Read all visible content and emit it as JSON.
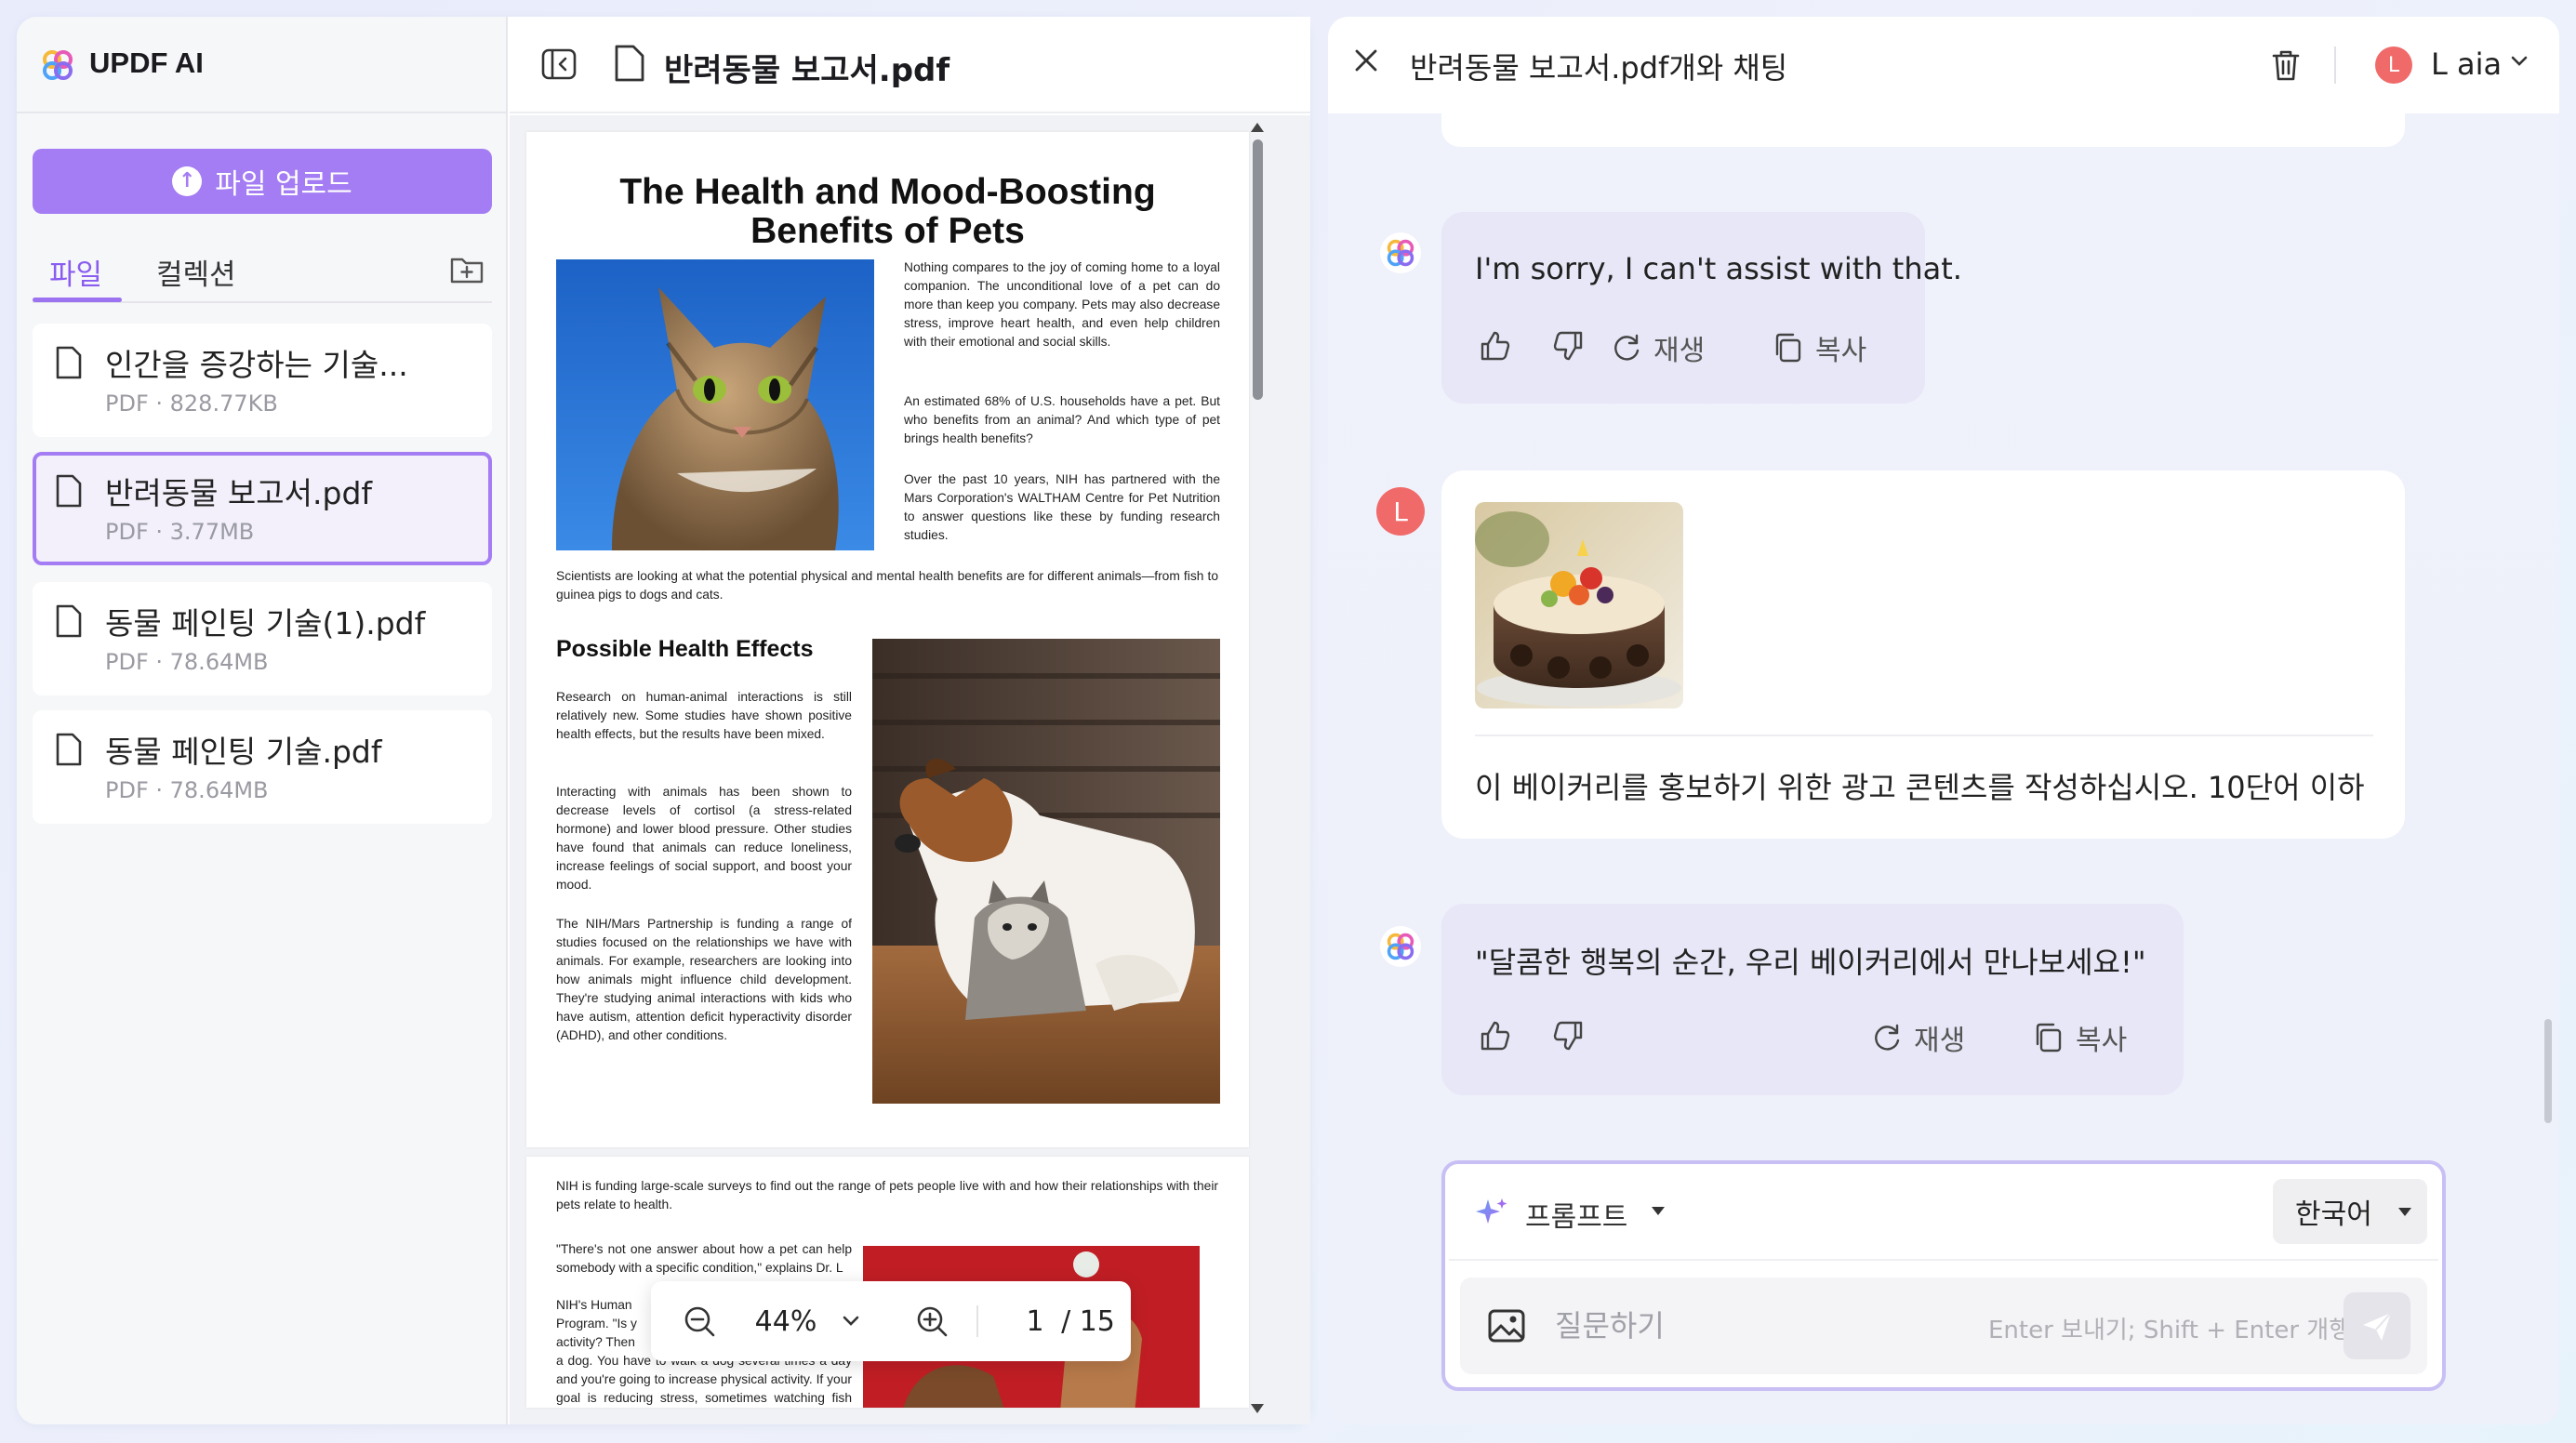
{
  "sidebar": {
    "app_title": "UPDF AI",
    "upload_label": "파일 업로드",
    "tabs": [
      {
        "label": "파일",
        "active": true
      },
      {
        "label": "컬렉션",
        "active": false
      }
    ],
    "files": [
      {
        "name": "인간을 증강하는 기술...",
        "meta": "PDF · 828.77KB",
        "selected": false
      },
      {
        "name": "반려동물 보고서.pdf",
        "meta": "PDF · 3.77MB",
        "selected": true
      },
      {
        "name": "동물 페인팅 기술(1).pdf",
        "meta": "PDF · 78.64MB",
        "selected": false
      },
      {
        "name": "동물 페인팅 기술.pdf",
        "meta": "PDF · 78.64MB",
        "selected": false
      }
    ]
  },
  "viewer": {
    "doc_title": "반려동물 보고서.pdf",
    "zoom": "44%",
    "page_current": "1",
    "page_total": "/ 15",
    "page1": {
      "title_line1": "The Health and Mood-Boosting",
      "title_line2": "Benefits of Pets",
      "intro_p1": "Nothing compares to the joy of coming home to a loyal companion. The unconditional love of a pet can do more than keep you company. Pets may also decrease stress, improve heart health, and even help children with their emotional and social skills.",
      "intro_p2": "An estimated 68% of U.S. households have a pet. But who benefits from an animal? And which type of pet brings health benefits?",
      "intro_p3": "Over the past 10 years, NIH has partnered with the Mars Corporation's WALTHAM Centre for Pet Nutrition to answer questions like these by funding research studies.",
      "scientists_p": "Scientists are looking at what the potential physical and mental health benefits are for different animals—from fish to guinea pigs to dogs and cats.",
      "section_heading": "Possible Health Effects",
      "effects_p1": "Research on human-animal interactions is still relatively new. Some studies have shown positive health effects, but the results have been mixed.",
      "effects_p2": "Interacting with animals has been shown to decrease levels of cortisol (a stress-related hormone) and lower blood pressure. Other studies have found that animals can reduce loneliness, increase feelings of social support, and boost your mood.",
      "effects_p3": "The NIH/Mars Partnership is funding a range of studies focused on the relationships we have with animals. For example, researchers are looking into how animals might influence child development. They're studying animal interactions with kids who have autism, attention deficit hyperactivity disorder (ADHD), and other conditions."
    },
    "page2": {
      "p1": "NIH is funding large-scale surveys to find out the range of pets people live with and how their relationships with their pets relate to health.",
      "p2": "\"There's not one answer about how a pet can help somebody with a specific condition,\" explains Dr. L",
      "p3": "NIH's Human",
      "p4": "Program. \"Is y",
      "p5": "activity? Then",
      "p6": "a dog. You have to walk a dog several times a day and you're going to increase physical activity. If your goal is reducing stress, sometimes watching fish swim can result in a"
    }
  },
  "chat": {
    "title": "반려동물 보고서.pdf개와 채팅",
    "user_initial": "L",
    "user_name": "L aia",
    "messages": [
      {
        "role": "ai",
        "text": "I'm sorry, I can't assist with that.",
        "regenerate": "재생",
        "copy": "복사"
      },
      {
        "role": "user",
        "text": "이 베이커리를 홍보하기 위한 광고 콘텐츠를 작성하십시오. 10단어 이하"
      },
      {
        "role": "ai",
        "text": "\"달콤한 행복의 순간, 우리 베이커리에서 만나보세요!\"",
        "regenerate": "재생",
        "copy": "복사"
      }
    ],
    "prompt_label": "프롬프트",
    "language": "한국어",
    "input_placeholder": "질문하기",
    "send_hint": "Enter 보내기; Shift + Enter 개행"
  },
  "colors": {
    "accent": "#a47cf3",
    "avatar": "#f06a6a",
    "ai_bubble": "#e7e7f7"
  }
}
